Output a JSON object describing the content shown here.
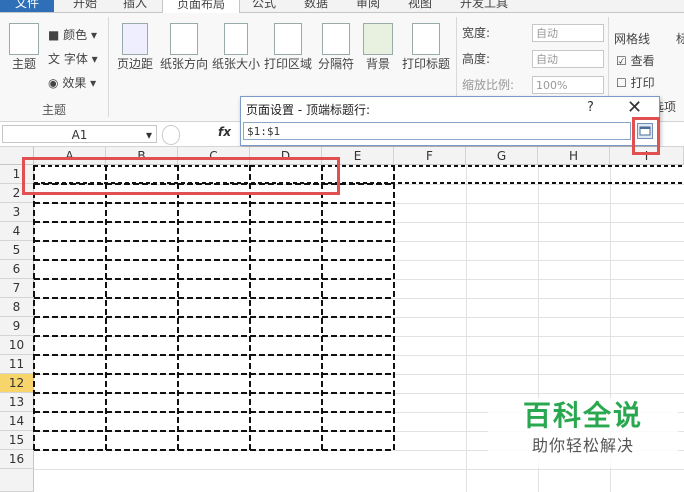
{
  "tabs": [
    "文件",
    "开始",
    "插入",
    "页面布局",
    "公式",
    "数据",
    "审阅",
    "视图",
    "开发工具"
  ],
  "ribbon": {
    "theme_label": "主题",
    "colors_label": "颜色",
    "fonts_label": "字体",
    "effects_label": "效果",
    "group_theme": "主题",
    "margins_label": "页边距",
    "orientation_label": "纸张方向",
    "size_label": "纸张大小",
    "print_area_label": "打印区域",
    "breaks_label": "分隔符",
    "background_label": "背景",
    "print_titles_label": "打印标题",
    "width_label": "宽度:",
    "height_label": "高度:",
    "scale_label": "缩放比例:",
    "width_value": "自动",
    "height_value": "自动",
    "scale_value": "100%",
    "gridlines_label": "网格线",
    "gridlines_view": "查看",
    "gridlines_print": "打印",
    "headings_partial": "标",
    "sheet_options_partial": "表选项"
  },
  "formula_bar": {
    "name_box": "A1",
    "fx": "fx"
  },
  "dialog": {
    "title": "页面设置 - 顶端标题行:",
    "help": "?",
    "close": "✕",
    "value": "$1:$1"
  },
  "columns": [
    "A",
    "B",
    "C",
    "D",
    "E",
    "F",
    "G",
    "H",
    "I"
  ],
  "rows": [
    "1",
    "2",
    "3",
    "4",
    "5",
    "6",
    "7",
    "8",
    "9",
    "10",
    "11",
    "12",
    "13",
    "14",
    "15",
    "16"
  ],
  "selected_row": "12",
  "watermark": {
    "title": "百科全说",
    "subtitle": "助你轻松解决"
  },
  "colors": {
    "file_tab": "#2f6fb7",
    "highlight": "#e05050",
    "watermark_green": "#2aa84f"
  }
}
